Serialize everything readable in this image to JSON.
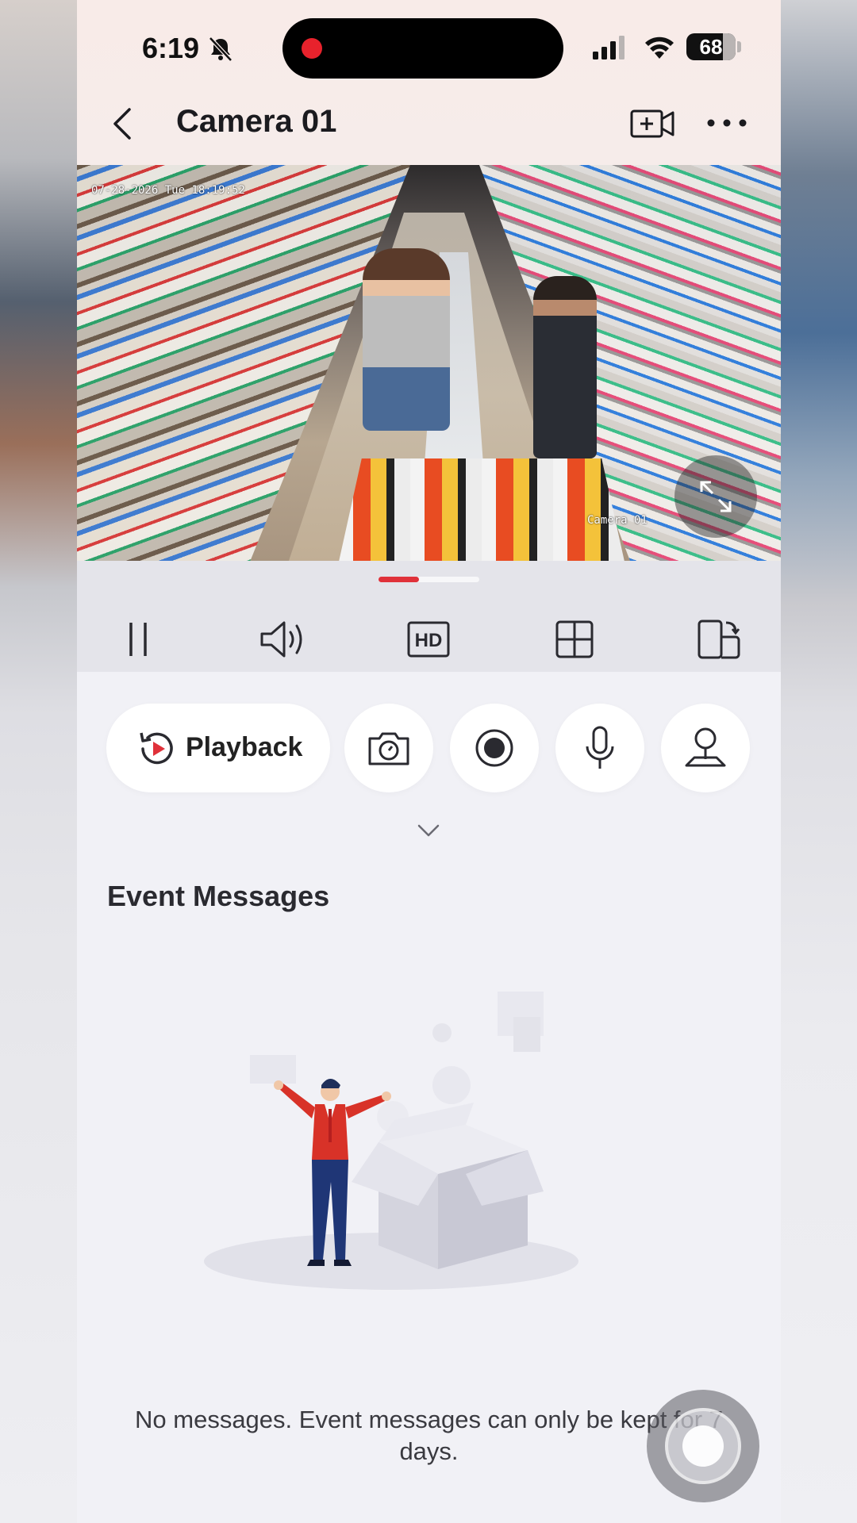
{
  "status_bar": {
    "time": "6:19",
    "battery": "68",
    "icons": [
      "bell-off-icon",
      "signal-icon",
      "wifi-icon",
      "battery-icon"
    ]
  },
  "header": {
    "title": "Camera 01",
    "back_icon": "chevron-left-icon",
    "add_camera_icon": "video-plus-icon",
    "more_icon": "more-horizontal-icon"
  },
  "video": {
    "timestamp": "07-28-2026 Tue 18:19:52",
    "camera_label": "Camera 01",
    "fullscreen_icon": "expand-icon"
  },
  "controls": {
    "progress_fraction": 0.4,
    "items": [
      {
        "name": "pause",
        "icon": "pause-icon"
      },
      {
        "name": "sound",
        "icon": "speaker-icon"
      },
      {
        "name": "hd",
        "icon": "hd-icon",
        "label": "HD"
      },
      {
        "name": "split-view",
        "icon": "grid-icon"
      },
      {
        "name": "rotate",
        "icon": "phone-rotate-icon"
      }
    ]
  },
  "actions": {
    "playback_label": "Playback",
    "buttons": [
      {
        "name": "screenshot",
        "icon": "camera-icon"
      },
      {
        "name": "record",
        "icon": "record-icon"
      },
      {
        "name": "talk",
        "icon": "microphone-icon"
      },
      {
        "name": "ptz",
        "icon": "ptz-icon"
      }
    ],
    "expand_icon": "chevron-down-icon"
  },
  "events": {
    "title": "Event Messages",
    "empty_text": "No messages. Event messages can only be kept for 7 days."
  },
  "colors": {
    "accent": "#e0313a",
    "header_bg": "#f8ebe8",
    "page_bg": "#f1f1f6",
    "control_bg": "#e4e4ea"
  }
}
